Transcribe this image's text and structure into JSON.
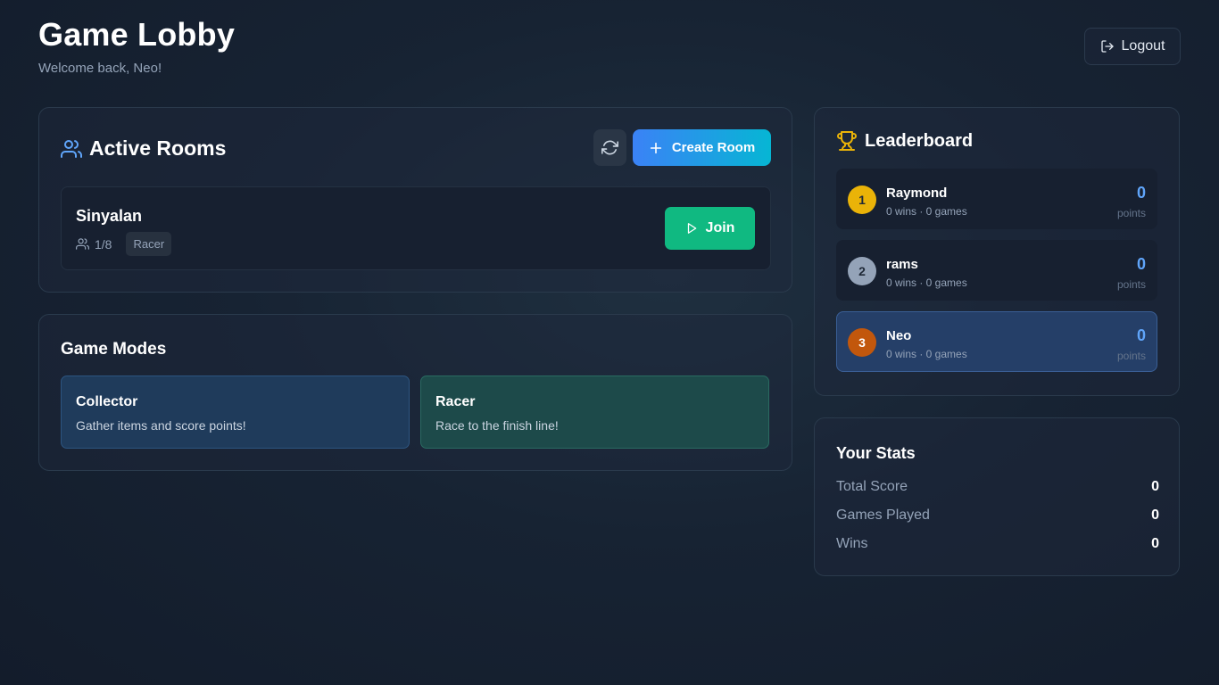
{
  "header": {
    "title": "Game Lobby",
    "subtitle": "Welcome back, Neo!",
    "logout_label": "Logout"
  },
  "rooms": {
    "title": "Active Rooms",
    "create_label": "Create Room",
    "icons": {
      "title": "users-icon",
      "refresh": "refresh-icon",
      "create": "plus-icon"
    },
    "items": [
      {
        "name": "Sinyalan",
        "players": "1/8",
        "mode": "Racer",
        "join_label": "Join"
      }
    ]
  },
  "modes": {
    "title": "Game Modes",
    "items": [
      {
        "name": "Collector",
        "description": "Gather items and score points!",
        "color": "#1f3b5b"
      },
      {
        "name": "Racer",
        "description": "Race to the finish line!",
        "color": "#1d4a4a"
      }
    ]
  },
  "leaderboard": {
    "title": "Leaderboard",
    "icon": "trophy-icon",
    "points_label": "points",
    "entries": [
      {
        "rank": "1",
        "name": "Raymond",
        "stats": "0 wins · 0 games",
        "points": "0",
        "badge_color": "#eab308"
      },
      {
        "rank": "2",
        "name": "rams",
        "stats": "0 wins · 0 games",
        "points": "0",
        "badge_color": "#94a3b8"
      },
      {
        "rank": "3",
        "name": "Neo",
        "stats": "0 wins · 0 games",
        "points": "0",
        "badge_color": "#c2570c",
        "current_user": true
      }
    ]
  },
  "stats": {
    "title": "Your Stats",
    "rows": [
      {
        "label": "Total Score",
        "value": "0"
      },
      {
        "label": "Games Played",
        "value": "0"
      },
      {
        "label": "Wins",
        "value": "0"
      }
    ]
  },
  "colors": {
    "accent_blue": "#3b82f6",
    "accent_cyan": "#06b6d4",
    "join_green": "#10b981",
    "points_blue": "#60a5fa"
  }
}
